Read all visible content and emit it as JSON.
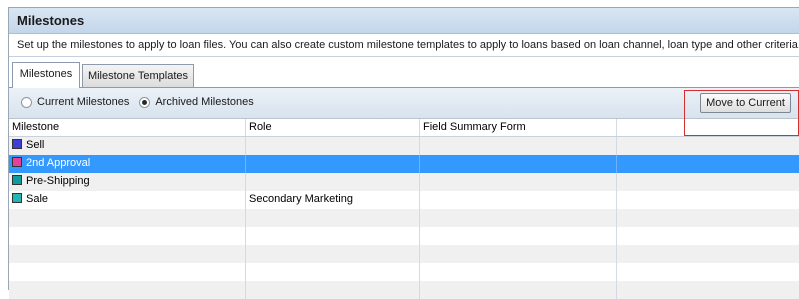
{
  "panel": {
    "title": "Milestones",
    "description": "Set up the milestones to apply to loan files. You can also create custom milestone templates to apply to loans based on loan channel, loan type and other criteria."
  },
  "tabs": [
    {
      "label": "Milestones",
      "active": true
    },
    {
      "label": "Milestone Templates",
      "active": false
    }
  ],
  "toolbar": {
    "radio_current": "Current Milestones",
    "radio_archived": "Archived Milestones",
    "selected": "Archived Milestones",
    "move_button": "Move to Current"
  },
  "grid": {
    "columns": [
      "Milestone",
      "Role",
      "Field Summary Form",
      ""
    ],
    "rows": [
      {
        "milestone": "Sell",
        "role": "",
        "form": "",
        "color": "#3f3fd8",
        "selected": false
      },
      {
        "milestone": "2nd Approval",
        "role": "",
        "form": "",
        "color": "#e6409a",
        "selected": true
      },
      {
        "milestone": "Pre-Shipping",
        "role": "",
        "form": "",
        "color": "#0f9c9c",
        "selected": false
      },
      {
        "milestone": "Sale",
        "role": "Secondary Marketing",
        "form": "",
        "color": "#26b3b3",
        "selected": false
      }
    ]
  },
  "colors": {
    "selection": "#3399ff",
    "highlight_box": "#d32f2f"
  }
}
